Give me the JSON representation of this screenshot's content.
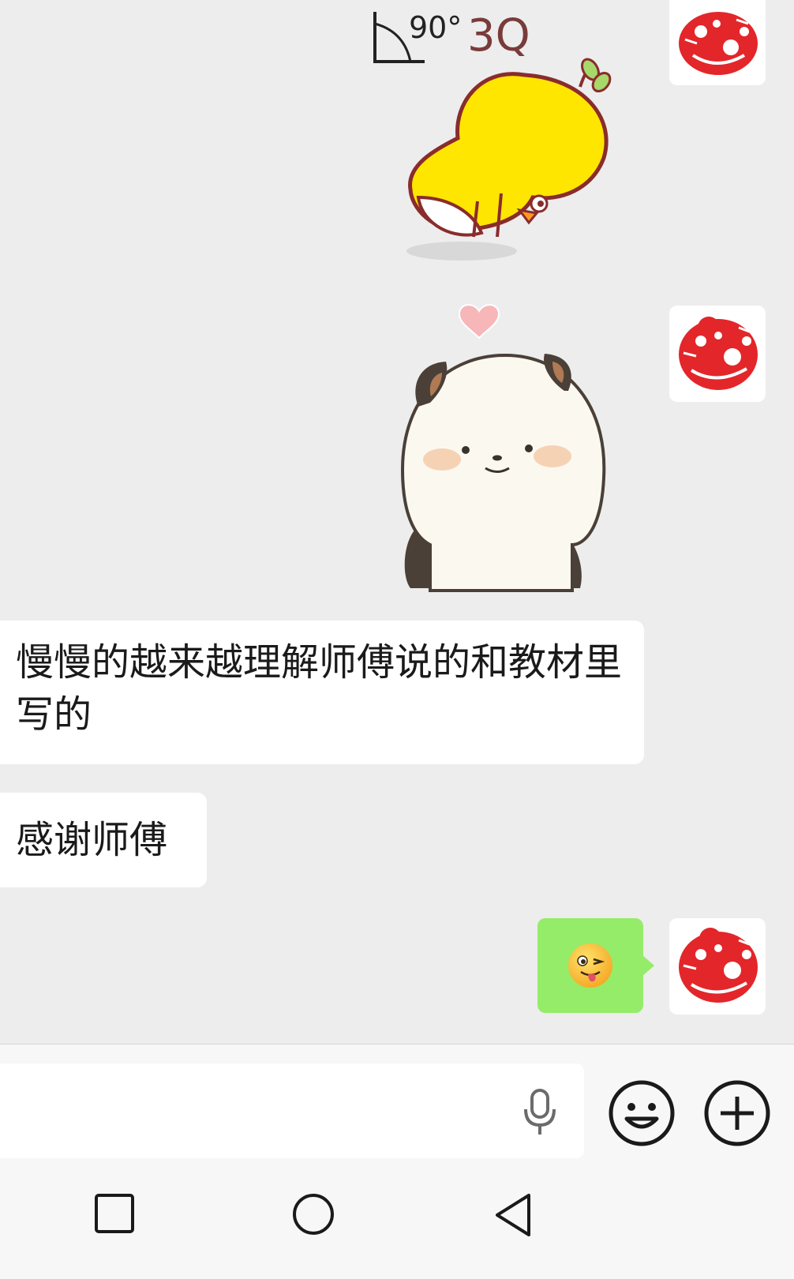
{
  "messages": {
    "text_1": "慢慢的越来越理解师傅说的和教材里写的",
    "text_2": "感谢师傅"
  },
  "stickers": {
    "sticker_1_caption": "90°",
    "sticker_1_caption_2": "3Q"
  },
  "reply_emoji": "winking-tongue-emoji",
  "input": {
    "placeholder": ""
  },
  "icons": {
    "voice": "microphone-icon",
    "emoji": "smiley-icon",
    "more": "plus-icon",
    "nav_recent": "square-icon",
    "nav_home": "circle-icon",
    "nav_back": "triangle-back-icon"
  },
  "colors": {
    "chat_bg": "#ededed",
    "sent_bubble": "#95ec69",
    "received_bubble": "#ffffff",
    "avatar_red": "#e3262a"
  }
}
